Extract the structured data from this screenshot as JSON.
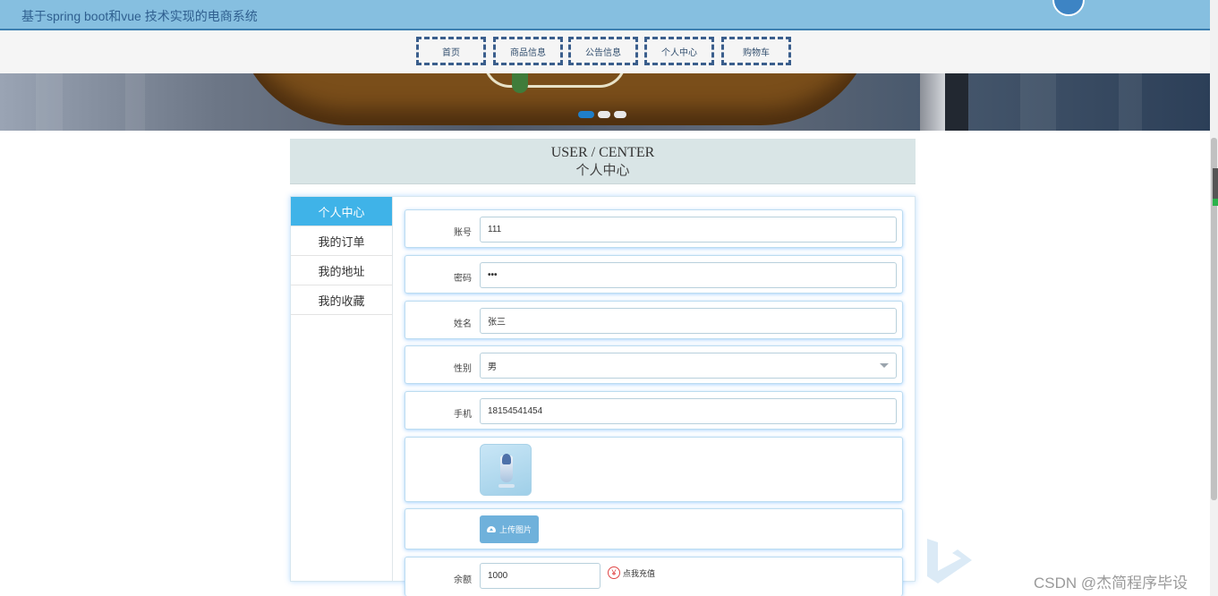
{
  "header": {
    "site_title": "基于spring boot和vue 技术实现的电商系统"
  },
  "nav": {
    "items": [
      {
        "label": "首页"
      },
      {
        "label": "商品信息"
      },
      {
        "label": "公告信息"
      },
      {
        "label": "个人中心"
      },
      {
        "label": "购物车"
      }
    ]
  },
  "banner": {
    "slide_count": 3,
    "active_slide": 1
  },
  "user_center": {
    "title_en": "USER / CENTER",
    "title_cn": "个人中心"
  },
  "sidebar": {
    "items": [
      {
        "label": "个人中心",
        "active": true
      },
      {
        "label": "我的订单",
        "active": false
      },
      {
        "label": "我的地址",
        "active": false
      },
      {
        "label": "我的收藏",
        "active": false
      }
    ]
  },
  "form": {
    "account": {
      "label": "账号",
      "value": "111"
    },
    "password": {
      "label": "密码",
      "value": "•••"
    },
    "name": {
      "label": "姓名",
      "value": "张三"
    },
    "gender": {
      "label": "性别",
      "value": "男"
    },
    "phone": {
      "label": "手机",
      "value": "18154541454"
    },
    "upload_button": "上传图片",
    "balance": {
      "label": "余额",
      "value": "1000"
    },
    "recharge_link": "点我充值",
    "recharge_icon": "¥"
  },
  "watermark": {
    "text": "CSDN @杰简程序毕设"
  },
  "colors": {
    "topbar": "#86bfe0",
    "accent": "#3fb3e8",
    "nav_border": "#3a5e8c",
    "upload_button": "#6fb1db"
  }
}
